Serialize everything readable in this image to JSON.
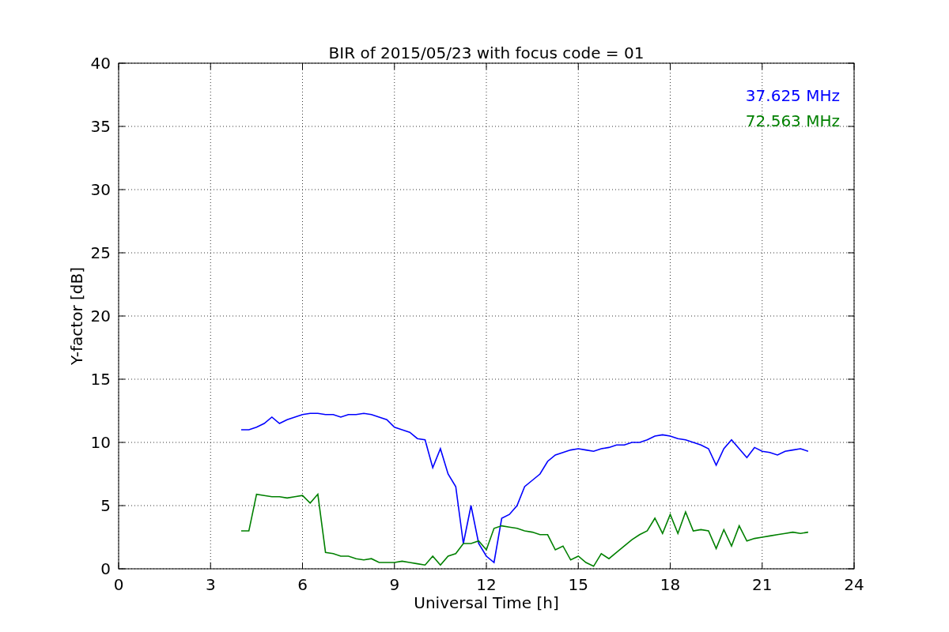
{
  "chart": {
    "chart_data": {
      "type": "line",
      "title": "BIR of 2015/05/23 with focus code = 01",
      "xlabel": "Universal Time [h]",
      "ylabel": "Y-factor [dB]",
      "x": [
        4,
        4.25,
        4.5,
        4.75,
        5,
        5.25,
        5.5,
        5.75,
        6,
        6.25,
        6.5,
        6.75,
        7,
        7.25,
        7.5,
        7.75,
        8,
        8.25,
        8.5,
        8.75,
        9,
        9.25,
        9.5,
        9.75,
        10,
        10.25,
        10.5,
        10.75,
        11,
        11.25,
        11.5,
        11.75,
        12,
        12.25,
        12.5,
        12.75,
        13,
        13.25,
        13.5,
        13.75,
        14,
        14.25,
        14.5,
        14.75,
        15,
        15.25,
        15.5,
        15.75,
        16,
        16.25,
        16.5,
        16.75,
        17,
        17.25,
        17.5,
        17.75,
        18,
        18.25,
        18.5,
        18.75,
        19,
        19.25,
        19.5,
        19.75,
        20,
        20.25,
        20.5,
        20.75,
        21,
        21.25,
        21.5,
        21.75,
        22,
        22.25,
        22.5
      ],
      "series": [
        {
          "name": "37.625 MHz",
          "color": "#0000ff",
          "values": [
            11,
            11,
            11.2,
            11.5,
            12,
            11.5,
            11.8,
            12,
            12.2,
            12.3,
            12.3,
            12.2,
            12.2,
            12,
            12.2,
            12.2,
            12.3,
            12.2,
            12,
            11.8,
            11.2,
            11,
            10.8,
            10.3,
            10.2,
            8,
            9.5,
            7.5,
            6.5,
            2,
            5,
            2,
            1,
            0.5,
            4,
            4.3,
            5,
            6.5,
            7,
            7.5,
            8.5,
            9,
            9.2,
            9.4,
            9.5,
            9.4,
            9.3,
            9.5,
            9.6,
            9.8,
            9.8,
            10,
            10,
            10.2,
            10.5,
            10.6,
            10.5,
            10.3,
            10.2,
            10,
            9.8,
            9.5,
            8.2,
            9.5,
            10.2,
            9.5,
            8.8,
            9.6,
            9.3,
            9.2,
            9,
            9.3,
            9.4,
            9.5,
            9.3
          ]
        },
        {
          "name": "72.563 MHz",
          "color": "#008000",
          "values": [
            3,
            3,
            5.9,
            5.8,
            5.7,
            5.7,
            5.6,
            5.7,
            5.8,
            5.2,
            5.9,
            1.3,
            1.2,
            1,
            1,
            0.8,
            0.7,
            0.8,
            0.5,
            0.5,
            0.5,
            0.6,
            0.5,
            0.4,
            0.3,
            1,
            0.3,
            1,
            1.2,
            2,
            2,
            2.2,
            1.5,
            3.2,
            3.4,
            3.3,
            3.2,
            3,
            2.9,
            2.7,
            2.7,
            1.5,
            1.8,
            0.7,
            1,
            0.5,
            0.2,
            1.2,
            0.8,
            1.3,
            1.8,
            2.3,
            2.7,
            3,
            4,
            2.8,
            4.3,
            2.8,
            4.5,
            3,
            3.1,
            3,
            1.6,
            3.1,
            1.8,
            3.4,
            2.2,
            2.4,
            2.5,
            2.6,
            2.7,
            2.8,
            2.9,
            2.8,
            2.9
          ]
        }
      ],
      "grid": true,
      "xlim": [
        0,
        24
      ],
      "ylim": [
        0,
        40
      ],
      "xticks": [
        0,
        3,
        6,
        9,
        12,
        15,
        18,
        21,
        24
      ],
      "yticks": [
        0,
        5,
        10,
        15,
        20,
        25,
        30,
        35,
        40
      ]
    }
  }
}
